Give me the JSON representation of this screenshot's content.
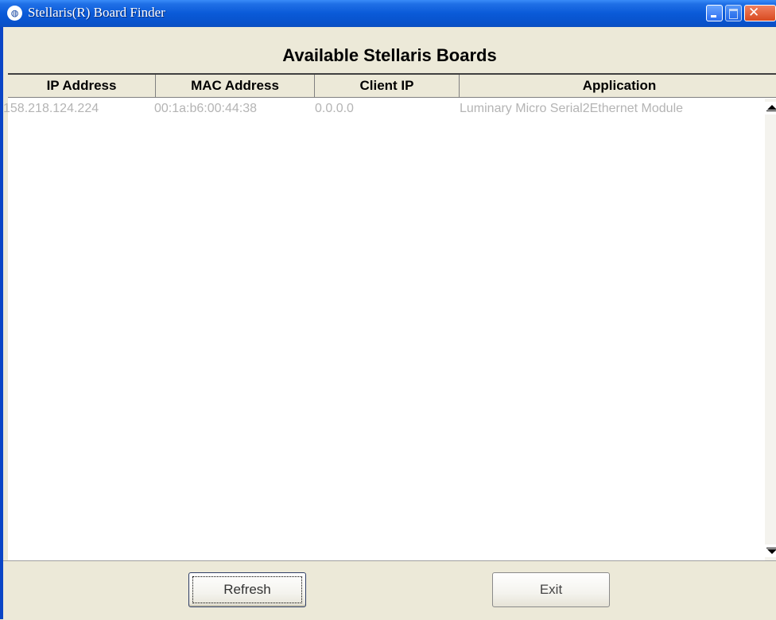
{
  "window": {
    "title": "Stellaris(R) Board Finder",
    "icon": "app-logo-icon",
    "icon_glyph": "◍",
    "controls": {
      "minimize": "",
      "maximize": "",
      "close": "✕"
    }
  },
  "header": {
    "title": "Available Stellaris Boards"
  },
  "list": {
    "columns": [
      "IP Address",
      "MAC Address",
      "Client IP",
      "Application"
    ],
    "rows": [
      {
        "ip": "158.218.124.224",
        "mac": "00:1a:b6:00:44:38",
        "client_ip": "0.0.0.0",
        "application": "Luminary Micro Serial2Ethernet Module"
      }
    ]
  },
  "buttons": {
    "refresh": "Refresh",
    "exit": "Exit"
  },
  "colors": {
    "titlebar": "#0a5ad8",
    "window_bg": "#ece9d8",
    "row_text": "#b4b4b4",
    "close_button": "#d84a20"
  }
}
